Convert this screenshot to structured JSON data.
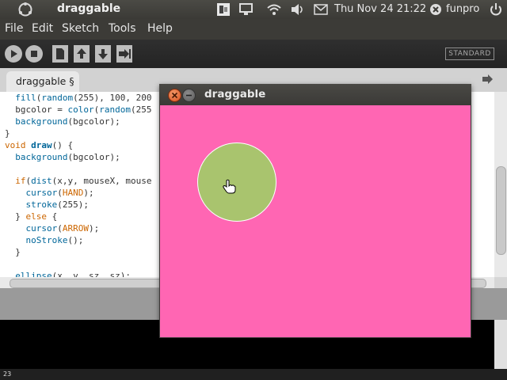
{
  "top_panel": {
    "app_title": "draggable",
    "clock": "Thu Nov 24 21:22",
    "user": "funpro"
  },
  "menubar": {
    "items": [
      "File",
      "Edit",
      "Sketch",
      "Tools",
      "Help"
    ]
  },
  "toolbar": {
    "buttons": [
      "run",
      "stop",
      "new",
      "open",
      "save",
      "export"
    ],
    "mode": "STANDARD"
  },
  "tab": {
    "label": "draggable §"
  },
  "editor": {
    "lines": [
      "  fill(random(255), 100, 200",
      "  bgcolor = color(random(255",
      "  background(bgcolor);",
      "}",
      "void draw() {",
      "  background(bgcolor);",
      "",
      "  if(dist(x,y, mouseX, mouse",
      "    cursor(HAND);",
      "    stroke(255);",
      "  } else {",
      "    cursor(ARROW);",
      "    noStroke();",
      "  }",
      "",
      "  ellipse(x, y, sz, sz);"
    ]
  },
  "sketch_window": {
    "title": "draggable",
    "canvas_color": "#ff66b3",
    "circle_color": "#a9c46e"
  },
  "bottom_bar": {
    "text": "23"
  },
  "colors": {
    "panel": "#3c3b37",
    "close": "#e05a26"
  }
}
